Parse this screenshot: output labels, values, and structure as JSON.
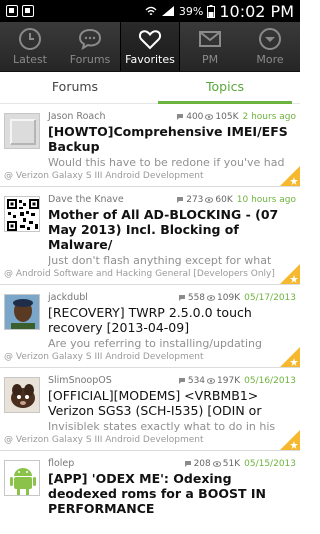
{
  "status": {
    "battery": "39%",
    "time": "10:02 PM"
  },
  "tabs": [
    {
      "label": "Latest"
    },
    {
      "label": "Forums"
    },
    {
      "label": "Favorites"
    },
    {
      "label": "PM"
    },
    {
      "label": "More"
    }
  ],
  "subtabs": [
    {
      "label": "Forums"
    },
    {
      "label": "Topics"
    }
  ],
  "topics": [
    {
      "author": "Jason Roach",
      "replies": "400",
      "views": "105K",
      "date": "2 hours ago",
      "title": "[HOWTO]Comprehensive IMEI/EFS Backup",
      "preview": "Would this have to be redone if you've had",
      "forum": "@ Verizon Galaxy S III Android Development"
    },
    {
      "author": "Dave the Knave",
      "replies": "273",
      "views": "60K",
      "date": "10 hours ago",
      "title": "Mother of All AD-BLOCKING - (07 May 2013) Incl. Blocking of Malware/",
      "preview": "Just don't flash anything except for what",
      "forum": "@ Android Software and Hacking General [Developers Only]"
    },
    {
      "author": "jackdubl",
      "replies": "558",
      "views": "109K",
      "date": "05/17/2013",
      "title": "[RECOVERY] TWRP 2.5.0.0 touch recovery [2013-04-09]",
      "preview": "Are you referring to installing/updating",
      "forum": "@ Verizon Galaxy S III Android Development"
    },
    {
      "author": "SlimSnoopOS",
      "replies": "534",
      "views": "197K",
      "date": "05/16/2013",
      "title": "[OFFICIAL][MODEMS] <VRBMB1> Verizon SGS3 (SCH-I535) [ODIN or",
      "preview": "Invisiblek states exactly what to do in his",
      "forum": "@ Verizon Galaxy S III Android Development"
    },
    {
      "author": "flolep",
      "replies": "208",
      "views": "51K",
      "date": "05/15/2013",
      "title": "[APP] 'ODEX ME': Odexing deodexed roms for a BOOST IN PERFORMANCE",
      "preview": "",
      "forum": ""
    }
  ],
  "colors": {
    "accent": "#6cb33f",
    "corner": "#f5b82e"
  }
}
